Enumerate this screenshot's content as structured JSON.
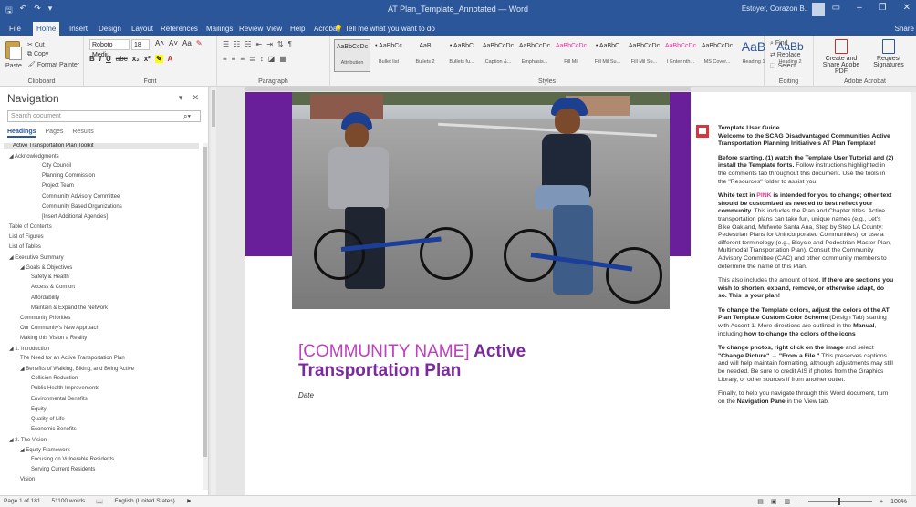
{
  "titlebar": {
    "quick_access": [
      "save-icon",
      "undo-icon",
      "redo-icon",
      "customize-icon"
    ],
    "document_title": "AT Plan_Template_Annotated — Word",
    "user": "Estoyer, Corazon B.",
    "window_controls": [
      "ribbon-display-icon",
      "minimize-icon",
      "restore-icon",
      "close-icon"
    ]
  },
  "tabs": {
    "items": [
      "File",
      "Home",
      "Insert",
      "Design",
      "Layout",
      "References",
      "Mailings",
      "Review",
      "View",
      "Help",
      "Acrobat"
    ],
    "active": "Home",
    "tell_me": "Tell me what you want to do",
    "share": "Share"
  },
  "ribbon": {
    "clipboard": {
      "label": "Clipboard",
      "paste": "Paste",
      "cut": "Cut",
      "copy": "Copy",
      "format_painter": "Format Painter"
    },
    "font": {
      "label": "Font",
      "font_name": "Roboto Mediu",
      "font_size": "18",
      "buttons": [
        "B",
        "I",
        "U",
        "abc",
        "x₂",
        "x²",
        "A"
      ]
    },
    "paragraph": {
      "label": "Paragraph"
    },
    "styles": {
      "label": "Styles",
      "items": [
        {
          "sample": "AaBbCcDc",
          "name": "Attribution"
        },
        {
          "sample": "• AaBbCc",
          "name": "Bullet list"
        },
        {
          "sample": "AaB",
          "name": "Bullets 2"
        },
        {
          "sample": "• AaBbC",
          "name": "Bullets fu..."
        },
        {
          "sample": "AaBbCcDc",
          "name": "Caption &..."
        },
        {
          "sample": "AaBbCcDc",
          "name": "Emphasis..."
        },
        {
          "sample": "AaBbCcDc",
          "name": "Fill Mil"
        },
        {
          "sample": "• AaBbC",
          "name": "Fill Mil Su..."
        },
        {
          "sample": "AaBbCcDc",
          "name": "Fill Mil Su..."
        },
        {
          "sample": "AaBbCcDc",
          "name": "I Enter nth..."
        },
        {
          "sample": "AaBbCcDc",
          "name": "MS Cover..."
        },
        {
          "sample": "AaB",
          "name": "Heading 1"
        },
        {
          "sample": "AaBb",
          "name": "Heading 2"
        }
      ]
    },
    "editing": {
      "label": "Editing",
      "find": "Find",
      "replace": "Replace",
      "select": "Select"
    },
    "acrobat": {
      "label": "Adobe Acrobat",
      "create": "Create and Share Adobe PDF",
      "request": "Request Signatures"
    }
  },
  "nav": {
    "title": "Navigation",
    "search_placeholder": "Search document",
    "tabs": [
      "Headings",
      "Pages",
      "Results"
    ],
    "active_tab": "Headings",
    "tree": [
      {
        "label": "Active Transportation Plan Toolkit",
        "level": 1,
        "selected": true
      },
      {
        "label": "◢ Acknowledgments",
        "level": 0
      },
      {
        "label": "City Council",
        "level": 3
      },
      {
        "label": "Planning Commission",
        "level": 3
      },
      {
        "label": "Project Team",
        "level": 3
      },
      {
        "label": "Community Advisory Committee",
        "level": 3
      },
      {
        "label": "Community Based Organizations",
        "level": 3
      },
      {
        "label": "[Insert Additional Agencies]",
        "level": 3
      },
      {
        "label": "Table of Contents",
        "level": 0
      },
      {
        "label": "List of Figures",
        "level": 0
      },
      {
        "label": "List of Tables",
        "level": 0
      },
      {
        "label": "◢ Executive Summary",
        "level": 0
      },
      {
        "label": "◢ Goals & Objectives",
        "level": 1
      },
      {
        "label": "Safety & Health",
        "level": 2
      },
      {
        "label": "Access & Comfort",
        "level": 2
      },
      {
        "label": "Affordability",
        "level": 2
      },
      {
        "label": "Maintain & Expand the Network",
        "level": 2
      },
      {
        "label": "Community Priorities",
        "level": 1
      },
      {
        "label": "Our Community's New Approach",
        "level": 1
      },
      {
        "label": "Making this Vision a Reality",
        "level": 1
      },
      {
        "label": "◢ 1. Introduction",
        "level": 0
      },
      {
        "label": "The Need for an Active Transportation Plan",
        "level": 1
      },
      {
        "label": "◢ Benefits of Walking, Biking, and Being Active",
        "level": 1
      },
      {
        "label": "Collision Reduction",
        "level": 2
      },
      {
        "label": "Public Health Improvements",
        "level": 2
      },
      {
        "label": "Environmental Benefits",
        "level": 2
      },
      {
        "label": "Equity",
        "level": 2
      },
      {
        "label": "Quality of Life",
        "level": 2
      },
      {
        "label": "Economic Benefits",
        "level": 2
      },
      {
        "label": "◢ 2. The Vision",
        "level": 0
      },
      {
        "label": "◢ Equity Framework",
        "level": 1
      },
      {
        "label": "Focusing on Vulnerable Residents",
        "level": 2
      },
      {
        "label": "Serving Current Residents",
        "level": 2
      },
      {
        "label": "Vision",
        "level": 1
      }
    ]
  },
  "document": {
    "title_placeholder": "[COMMUNITY NAME]",
    "title_rest_1": " Active",
    "title_line_2": "Transportation Plan",
    "date": "Date",
    "colors": {
      "band": "#6a1f9a",
      "title": "#7a2a9c",
      "placeholder": "#c23ec2"
    }
  },
  "comment": {
    "p1_title": "Template User Guide",
    "p1_body": "Welcome to the SCAG Disadvantaged Communities Active Transportation Planning Initiative's AT Plan Template!",
    "p2_bold": "Before starting, (1) watch the Template User Tutorial and (2) install the Template fonts.",
    "p2_body": " Follow instructions highlighted in the comments tab throughout this document. Use the tools in the \"Resources\" folder to assist you.",
    "p3_a": "White text in ",
    "p3_pink": "PINK",
    "p3_b": " is intended for you to change; other text should be customized as needed to best reflect your community.",
    "p3_body": " This includes the Plan and Chapter titles. Active transportation plans can take fun, unique names (e.g., Let's Bike Oakland, Mufwete Santa Ana, Step by Step LA County: Pedestrian Plans for Unincorporated Communities), or use a different terminology (e.g., Bicycle and Pedestrian Master Plan, Multimodal Transportation Plan). Consult the Community Advisory Committee (CAC) and other community members to determine the name of this Plan.",
    "p4_a": "This also includes the amount of text. ",
    "p4_bold": "If there are sections you wish to shorten, expand, remove, or otherwise adapt, do so. This is your plan!",
    "p5_bold": "To change the Template colors, adjust the colors of the AT Plan Template Custom Color Scheme",
    "p5_body": " (Design Tab) starting with Accent 1. More directions are outlined in the ",
    "p5_manual": "Manual",
    "p5_end": ", including ",
    "p5_how": "how to change the colors of the icons",
    "p6_a": "To change photos, right click on the image",
    "p6_b": " and select ",
    "p6_c": "\"Change Picture\" → \"From a File.\"",
    "p6_body": " This preserves captions and will help maintain formatting, although adjustments may still be needed. Be sure to credit AIS if photos from the Graphics Library, or other sources if from another outlet.",
    "p7": "Finally, to help you navigate through this Word document, turn on the ",
    "p7_bold": "Navigation Pane",
    "p7_end": " in the View tab."
  },
  "status": {
    "page": "Page 1 of 181",
    "words": "51100 words",
    "language": "English (United States)",
    "zoom": "100%"
  }
}
